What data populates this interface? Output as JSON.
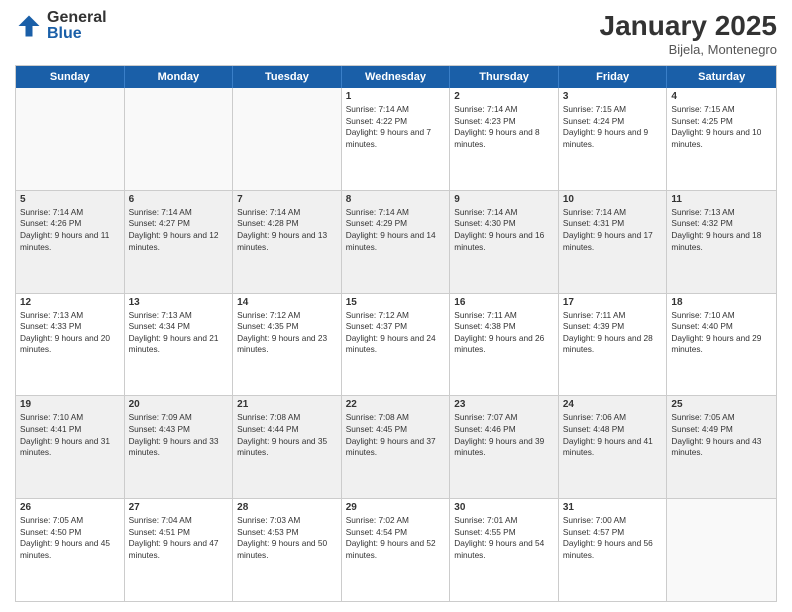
{
  "logo": {
    "general": "General",
    "blue": "Blue"
  },
  "title": "January 2025",
  "location": "Bijela, Montenegro",
  "weekdays": [
    "Sunday",
    "Monday",
    "Tuesday",
    "Wednesday",
    "Thursday",
    "Friday",
    "Saturday"
  ],
  "rows": [
    {
      "shaded": false,
      "cells": [
        {
          "day": "",
          "sunrise": "",
          "sunset": "",
          "daylight": ""
        },
        {
          "day": "",
          "sunrise": "",
          "sunset": "",
          "daylight": ""
        },
        {
          "day": "",
          "sunrise": "",
          "sunset": "",
          "daylight": ""
        },
        {
          "day": "1",
          "sunrise": "Sunrise: 7:14 AM",
          "sunset": "Sunset: 4:22 PM",
          "daylight": "Daylight: 9 hours and 7 minutes."
        },
        {
          "day": "2",
          "sunrise": "Sunrise: 7:14 AM",
          "sunset": "Sunset: 4:23 PM",
          "daylight": "Daylight: 9 hours and 8 minutes."
        },
        {
          "day": "3",
          "sunrise": "Sunrise: 7:15 AM",
          "sunset": "Sunset: 4:24 PM",
          "daylight": "Daylight: 9 hours and 9 minutes."
        },
        {
          "day": "4",
          "sunrise": "Sunrise: 7:15 AM",
          "sunset": "Sunset: 4:25 PM",
          "daylight": "Daylight: 9 hours and 10 minutes."
        }
      ]
    },
    {
      "shaded": true,
      "cells": [
        {
          "day": "5",
          "sunrise": "Sunrise: 7:14 AM",
          "sunset": "Sunset: 4:26 PM",
          "daylight": "Daylight: 9 hours and 11 minutes."
        },
        {
          "day": "6",
          "sunrise": "Sunrise: 7:14 AM",
          "sunset": "Sunset: 4:27 PM",
          "daylight": "Daylight: 9 hours and 12 minutes."
        },
        {
          "day": "7",
          "sunrise": "Sunrise: 7:14 AM",
          "sunset": "Sunset: 4:28 PM",
          "daylight": "Daylight: 9 hours and 13 minutes."
        },
        {
          "day": "8",
          "sunrise": "Sunrise: 7:14 AM",
          "sunset": "Sunset: 4:29 PM",
          "daylight": "Daylight: 9 hours and 14 minutes."
        },
        {
          "day": "9",
          "sunrise": "Sunrise: 7:14 AM",
          "sunset": "Sunset: 4:30 PM",
          "daylight": "Daylight: 9 hours and 16 minutes."
        },
        {
          "day": "10",
          "sunrise": "Sunrise: 7:14 AM",
          "sunset": "Sunset: 4:31 PM",
          "daylight": "Daylight: 9 hours and 17 minutes."
        },
        {
          "day": "11",
          "sunrise": "Sunrise: 7:13 AM",
          "sunset": "Sunset: 4:32 PM",
          "daylight": "Daylight: 9 hours and 18 minutes."
        }
      ]
    },
    {
      "shaded": false,
      "cells": [
        {
          "day": "12",
          "sunrise": "Sunrise: 7:13 AM",
          "sunset": "Sunset: 4:33 PM",
          "daylight": "Daylight: 9 hours and 20 minutes."
        },
        {
          "day": "13",
          "sunrise": "Sunrise: 7:13 AM",
          "sunset": "Sunset: 4:34 PM",
          "daylight": "Daylight: 9 hours and 21 minutes."
        },
        {
          "day": "14",
          "sunrise": "Sunrise: 7:12 AM",
          "sunset": "Sunset: 4:35 PM",
          "daylight": "Daylight: 9 hours and 23 minutes."
        },
        {
          "day": "15",
          "sunrise": "Sunrise: 7:12 AM",
          "sunset": "Sunset: 4:37 PM",
          "daylight": "Daylight: 9 hours and 24 minutes."
        },
        {
          "day": "16",
          "sunrise": "Sunrise: 7:11 AM",
          "sunset": "Sunset: 4:38 PM",
          "daylight": "Daylight: 9 hours and 26 minutes."
        },
        {
          "day": "17",
          "sunrise": "Sunrise: 7:11 AM",
          "sunset": "Sunset: 4:39 PM",
          "daylight": "Daylight: 9 hours and 28 minutes."
        },
        {
          "day": "18",
          "sunrise": "Sunrise: 7:10 AM",
          "sunset": "Sunset: 4:40 PM",
          "daylight": "Daylight: 9 hours and 29 minutes."
        }
      ]
    },
    {
      "shaded": true,
      "cells": [
        {
          "day": "19",
          "sunrise": "Sunrise: 7:10 AM",
          "sunset": "Sunset: 4:41 PM",
          "daylight": "Daylight: 9 hours and 31 minutes."
        },
        {
          "day": "20",
          "sunrise": "Sunrise: 7:09 AM",
          "sunset": "Sunset: 4:43 PM",
          "daylight": "Daylight: 9 hours and 33 minutes."
        },
        {
          "day": "21",
          "sunrise": "Sunrise: 7:08 AM",
          "sunset": "Sunset: 4:44 PM",
          "daylight": "Daylight: 9 hours and 35 minutes."
        },
        {
          "day": "22",
          "sunrise": "Sunrise: 7:08 AM",
          "sunset": "Sunset: 4:45 PM",
          "daylight": "Daylight: 9 hours and 37 minutes."
        },
        {
          "day": "23",
          "sunrise": "Sunrise: 7:07 AM",
          "sunset": "Sunset: 4:46 PM",
          "daylight": "Daylight: 9 hours and 39 minutes."
        },
        {
          "day": "24",
          "sunrise": "Sunrise: 7:06 AM",
          "sunset": "Sunset: 4:48 PM",
          "daylight": "Daylight: 9 hours and 41 minutes."
        },
        {
          "day": "25",
          "sunrise": "Sunrise: 7:05 AM",
          "sunset": "Sunset: 4:49 PM",
          "daylight": "Daylight: 9 hours and 43 minutes."
        }
      ]
    },
    {
      "shaded": false,
      "cells": [
        {
          "day": "26",
          "sunrise": "Sunrise: 7:05 AM",
          "sunset": "Sunset: 4:50 PM",
          "daylight": "Daylight: 9 hours and 45 minutes."
        },
        {
          "day": "27",
          "sunrise": "Sunrise: 7:04 AM",
          "sunset": "Sunset: 4:51 PM",
          "daylight": "Daylight: 9 hours and 47 minutes."
        },
        {
          "day": "28",
          "sunrise": "Sunrise: 7:03 AM",
          "sunset": "Sunset: 4:53 PM",
          "daylight": "Daylight: 9 hours and 50 minutes."
        },
        {
          "day": "29",
          "sunrise": "Sunrise: 7:02 AM",
          "sunset": "Sunset: 4:54 PM",
          "daylight": "Daylight: 9 hours and 52 minutes."
        },
        {
          "day": "30",
          "sunrise": "Sunrise: 7:01 AM",
          "sunset": "Sunset: 4:55 PM",
          "daylight": "Daylight: 9 hours and 54 minutes."
        },
        {
          "day": "31",
          "sunrise": "Sunrise: 7:00 AM",
          "sunset": "Sunset: 4:57 PM",
          "daylight": "Daylight: 9 hours and 56 minutes."
        },
        {
          "day": "",
          "sunrise": "",
          "sunset": "",
          "daylight": ""
        }
      ]
    }
  ]
}
